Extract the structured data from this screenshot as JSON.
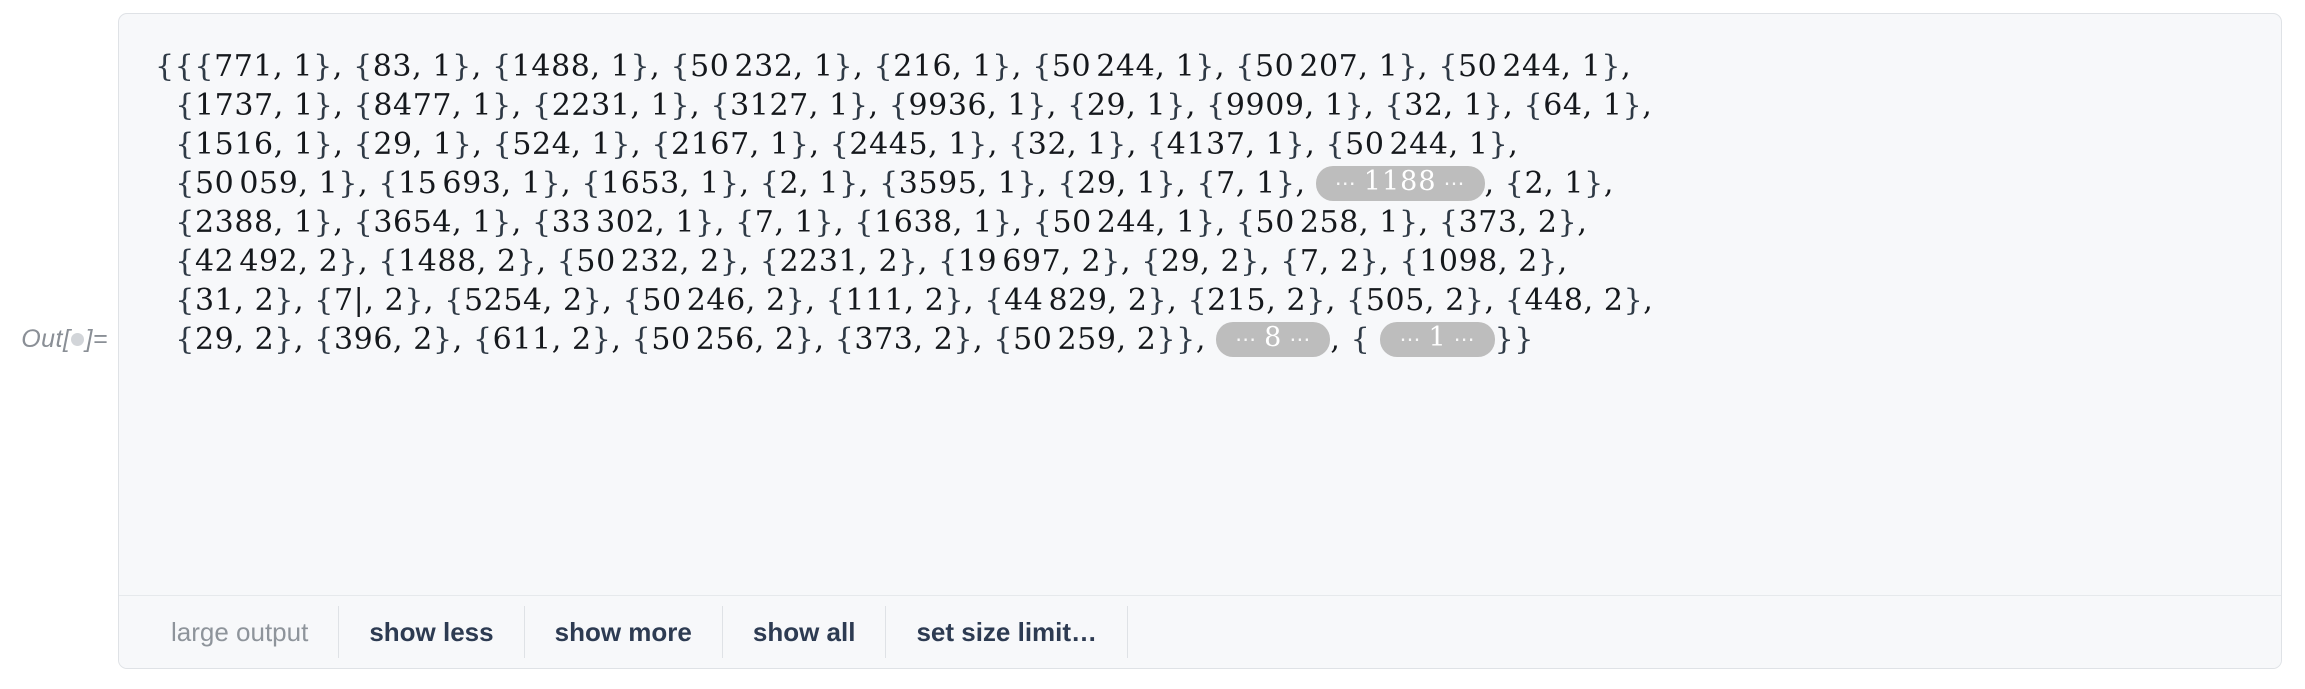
{
  "out_label": {
    "prefix": "Out[",
    "suffix": "]=",
    "bullet_icon": "collapsed-dot-icon"
  },
  "cell": {
    "background": "#f7f8fa",
    "border_color": "#dfe2e6"
  },
  "elide_badge": {
    "background": "#bdbdbd",
    "text_color": "#ffffff",
    "dots": "⋯"
  },
  "expression": {
    "lines": [
      "{{{771, 1}, {83, 1}, {1488, 1}, {50 232, 1}, {216, 1}, {50 244, 1}, {50 207, 1}, {50 244, 1},",
      "{1737, 1}, {8477, 1}, {2231, 1}, {3127, 1}, {9936, 1}, {29, 1}, {9909, 1}, {32, 1}, {64, 1},",
      "{1516, 1}, {29, 1}, {524, 1}, {2167, 1}, {2445, 1}, {32, 1}, {4137, 1}, {50 244, 1},",
      "{50 059, 1}, {15 693, 1}, {1653, 1}, {2, 1}, {3595, 1}, {29, 1}, {7, 1}, [ELIDE:1188], {2, 1},",
      "{2388, 1}, {3654, 1}, {33 302, 1}, {7, 1}, {1638, 1}, {50 244, 1}, {50 258, 1}, {373, 2},",
      "{42 492, 2}, {1488, 2}, {50 232, 2}, {2231, 2}, {19 697, 2}, {29, 2}, {7, 2}, {1098, 2},",
      "{31, 2}, {7|, 2}, {5254, 2}, {50 246, 2}, {111, 2}, {44 829, 2}, {215, 2}, {505, 2}, {448, 2},",
      "{29, 2}, {396, 2}, {611, 2}, {50 256, 2}, {373, 2}, {50 259, 2}}, [ELIDE:8], { [ELIDE:1] }}"
    ],
    "elided_counts": [
      "1188",
      "8",
      "1"
    ]
  },
  "toolbar": {
    "status_label": "large output",
    "show_less_label": "show less",
    "show_more_label": "show more",
    "show_all_label": "show all",
    "set_size_limit_label": "set size limit…"
  }
}
